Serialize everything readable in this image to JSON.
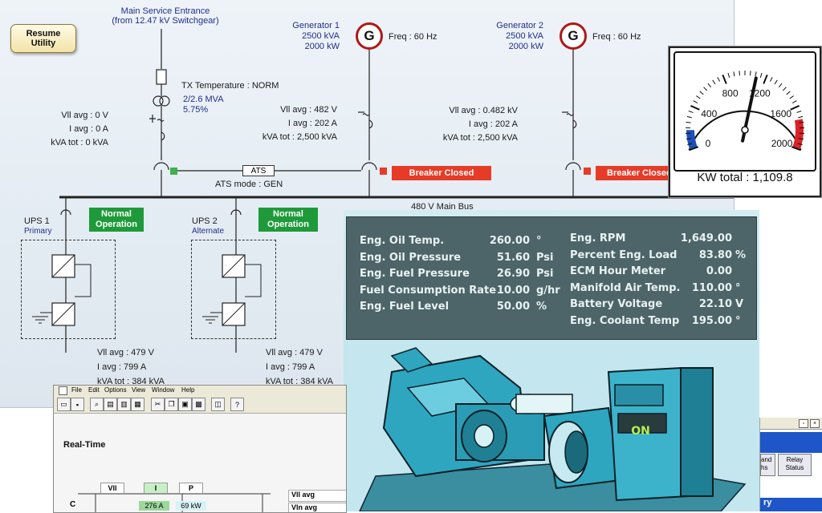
{
  "oneline": {
    "resume_button": "Resume\nUtility",
    "main_service": "Main Service Entrance",
    "main_service_sub": "(from 12.47 kV Switchgear)",
    "tx_temp": "TX Temperature : NORM",
    "tx_mva": "2/2.6 MVA",
    "tx_pct": "5.75%",
    "util_vll": "Vll avg : 0 V",
    "util_i": "I avg : 0 A",
    "util_kva": "kVA tot : 0 kVA",
    "gen1_name": "Generator 1",
    "gen1_kva": "2500 kVA",
    "gen1_kw": "2000 kW",
    "gen1_freq": "Freq : 60 Hz",
    "gen2_name": "Generator 2",
    "gen2_kva": "2500 kVA",
    "gen2_kw": "2000 kW",
    "gen2_freq": "Freq : 60 Hz",
    "gen_symbol": "G",
    "g1_vll": "Vll avg : 482 V",
    "g1_i": "I avg : 202 A",
    "g1_kva": "kVA tot : 2,500 kVA",
    "g2_vll": "Vll avg : 0.482 kV",
    "g2_i": "I avg : 202 A",
    "g2_kva": "kVA tot : 2,500 kVA",
    "ats": "ATS",
    "ats_mode": "ATS mode : GEN",
    "breaker1": "Breaker Closed",
    "breaker2": "Breaker Closed",
    "main_bus": "480 V Main Bus",
    "ups1_name": "UPS 1",
    "ups1_sub": "Primary",
    "ups2_name": "UPS 2",
    "ups2_sub": "Alternate",
    "normal1": "Normal\nOperation",
    "normal2": "Normal\nOperation",
    "u1_vll": "Vll avg : 479 V",
    "u1_i": "I avg : 799 A",
    "u1_kva": "kVA tot : 384 kVA",
    "u2_vll": "Vll avg : 479 V",
    "u2_i": "I avg : 799 A",
    "u2_kva": "kVA tot : 384 kVA"
  },
  "gauge": {
    "ticks": [
      "0",
      "400",
      "800",
      "1200",
      "1600",
      "2000"
    ],
    "value": 1109.8,
    "max": 2000,
    "label": "KW total : 1,109.8"
  },
  "engine": {
    "left": [
      {
        "label": "Eng. Oil Temp.",
        "value": "260.00",
        "unit": "°"
      },
      {
        "label": "Eng. Oil Pressure",
        "value": "51.60",
        "unit": "Psi"
      },
      {
        "label": "Eng. Fuel Pressure",
        "value": "26.90",
        "unit": "Psi"
      },
      {
        "label": "Fuel Consumption Rate",
        "value": "10.00",
        "unit": "g/hr"
      },
      {
        "label": "Eng. Fuel Level",
        "value": "50.00",
        "unit": "%"
      }
    ],
    "right": [
      {
        "label": "Eng. RPM",
        "value": "1,649.00",
        "unit": ""
      },
      {
        "label": "Percent Eng. Load",
        "value": "83.80",
        "unit": "%"
      },
      {
        "label": "ECM Hour Meter",
        "value": "0.00",
        "unit": ""
      },
      {
        "label": "Manifold Air Temp.",
        "value": "110.00",
        "unit": "°"
      },
      {
        "label": "Battery Voltage",
        "value": "22.10",
        "unit": "V"
      },
      {
        "label": "Eng. Coolant Temp",
        "value": "195.00",
        "unit": "°"
      }
    ],
    "on_label": "ON"
  },
  "realtime": {
    "menu": [
      "File",
      "Edit",
      "Options",
      "View",
      "Window",
      "Help"
    ],
    "title": "Real-Time",
    "col_vll": "Vll",
    "col_i": "I",
    "col_p": "P",
    "row_c": "C",
    "val_i": "276 A",
    "val_p": "69 kW",
    "side1": "Vll avg",
    "side2": "Vln avg"
  },
  "relay": {
    "btn1": "and\nhs",
    "btn2": "Relay\nStatus",
    "bottom": "ry"
  },
  "colors": {
    "breaker_red": "#e63b27",
    "normal_green": "#1f9a3a",
    "engine_teal": "#2aa5bd"
  }
}
